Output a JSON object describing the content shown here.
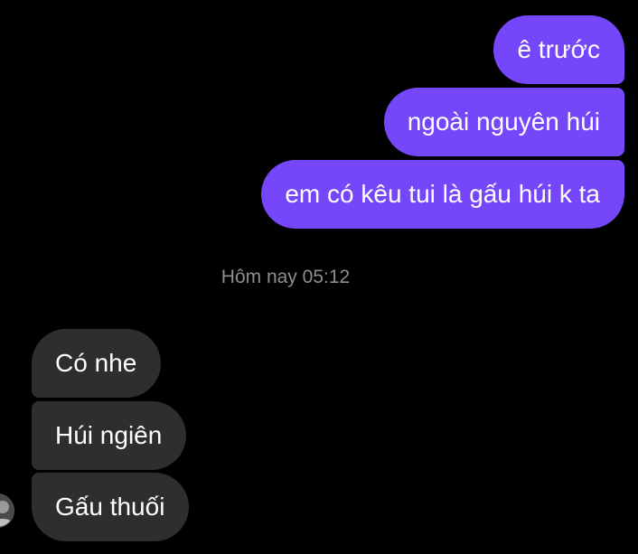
{
  "messages": {
    "outgoing": [
      {
        "text": "ê trước"
      },
      {
        "text": "ngoài nguyên húi"
      },
      {
        "text": "em có kêu tui là gấu húi k ta"
      }
    ],
    "timestamp": "Hôm nay 05:12",
    "incoming": [
      {
        "text": "Có nhe"
      },
      {
        "text": "Húi ngiên"
      },
      {
        "text": "Gấu thuối"
      }
    ]
  },
  "colors": {
    "background": "#000000",
    "outgoing_bubble": "#7646FA",
    "incoming_bubble": "#2E2E2E",
    "timestamp_text": "#8E8E8E"
  },
  "icons": {
    "avatar": "contact-avatar"
  }
}
